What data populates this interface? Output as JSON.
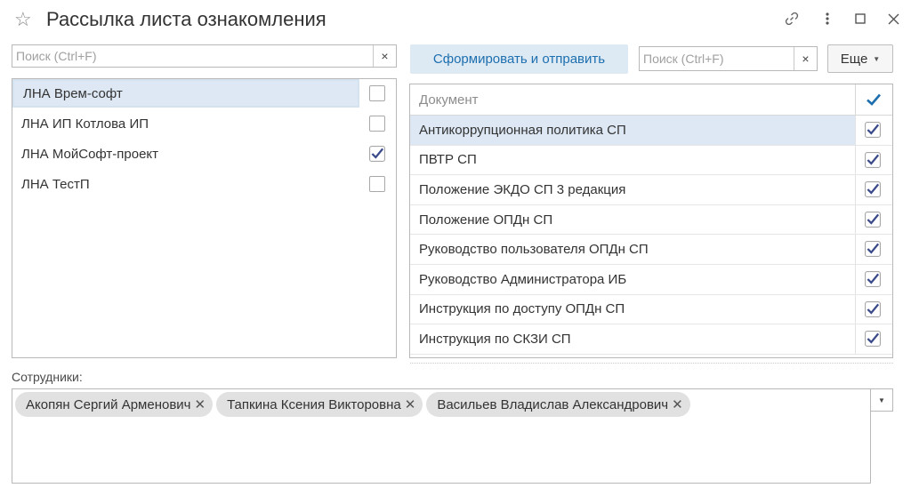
{
  "window": {
    "title": "Рассылка листа ознакомления"
  },
  "left_search": {
    "placeholder": "Поиск (Ctrl+F)",
    "clear": "×"
  },
  "toolbar": {
    "send_label": "Сформировать и отправить",
    "more_label": "Еще"
  },
  "right_search": {
    "placeholder": "Поиск (Ctrl+F)",
    "clear": "×"
  },
  "lna_list": [
    {
      "name": "ЛНА Врем-софт",
      "checked": false,
      "selected": true
    },
    {
      "name": "ЛНА ИП Котлова ИП",
      "checked": false,
      "selected": false
    },
    {
      "name": "ЛНА МойСофт-проект",
      "checked": true,
      "selected": false
    },
    {
      "name": "ЛНА ТестП",
      "checked": false,
      "selected": false
    }
  ],
  "documents": {
    "header": "Документ",
    "rows": [
      {
        "name": "Антикоррупционная политика СП",
        "checked": true,
        "selected": true
      },
      {
        "name": "ПВТР СП",
        "checked": true,
        "selected": false
      },
      {
        "name": "Положение ЭКДО СП 3 редакция",
        "checked": true,
        "selected": false
      },
      {
        "name": "Положение ОПДн СП",
        "checked": true,
        "selected": false
      },
      {
        "name": "Руководство пользователя ОПДн СП",
        "checked": true,
        "selected": false
      },
      {
        "name": "Руководство Администратора ИБ",
        "checked": true,
        "selected": false
      },
      {
        "name": "Инструкция по доступу ОПДн СП",
        "checked": true,
        "selected": false
      },
      {
        "name": "Инструкция по СКЗИ СП",
        "checked": true,
        "selected": false
      }
    ]
  },
  "employees": {
    "label": "Сотрудники:",
    "tags": [
      "Акопян Сергий Арменович",
      "Тапкина Ксения Викторовна",
      "Васильев Владислав Александрович"
    ]
  },
  "colors": {
    "accent": "#1d6faf",
    "check": "#3b4a8a",
    "selected_row": "#dde8f4"
  }
}
